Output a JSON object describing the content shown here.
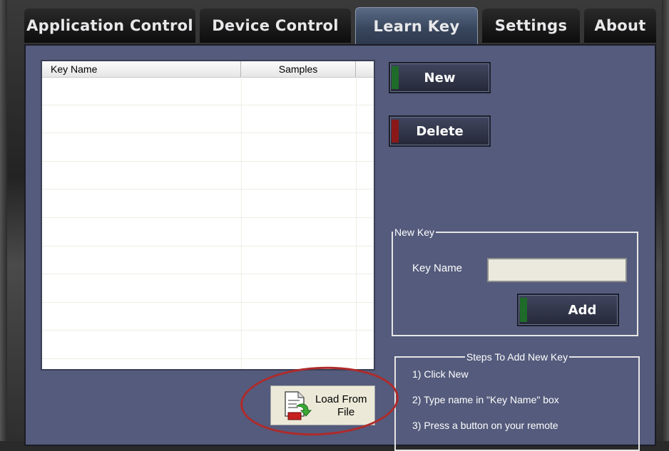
{
  "tabs": [
    {
      "label": "Application Control",
      "active": false
    },
    {
      "label": "Device Control",
      "active": false
    },
    {
      "label": "Learn Key",
      "active": true
    },
    {
      "label": "Settings",
      "active": false
    },
    {
      "label": "About",
      "active": false
    }
  ],
  "keylist": {
    "columns": [
      "Key Name",
      "Samples"
    ],
    "rows": []
  },
  "buttons": {
    "new_label": "New",
    "delete_label": "Delete",
    "add_label": "Add",
    "load_line1": "Load From",
    "load_line2": "File"
  },
  "new_key_group": {
    "legend": "New Key",
    "key_name_label": "Key Name",
    "key_name_value": ""
  },
  "steps_group": {
    "legend": "Steps To Add New Key",
    "steps": [
      "1) Click New",
      "2) Type name in \"Key Name\" box",
      "3) Press a button on your remote"
    ]
  },
  "colors": {
    "panel_bg": "#545b7c",
    "new_accent": "#1e6b2a",
    "delete_accent": "#8b1818",
    "add_accent": "#1e6b2a",
    "highlight_ellipse": "#b02a2a"
  },
  "icons": {
    "load_file_icon": "document-with-green-arrow-and-KEY-label"
  }
}
